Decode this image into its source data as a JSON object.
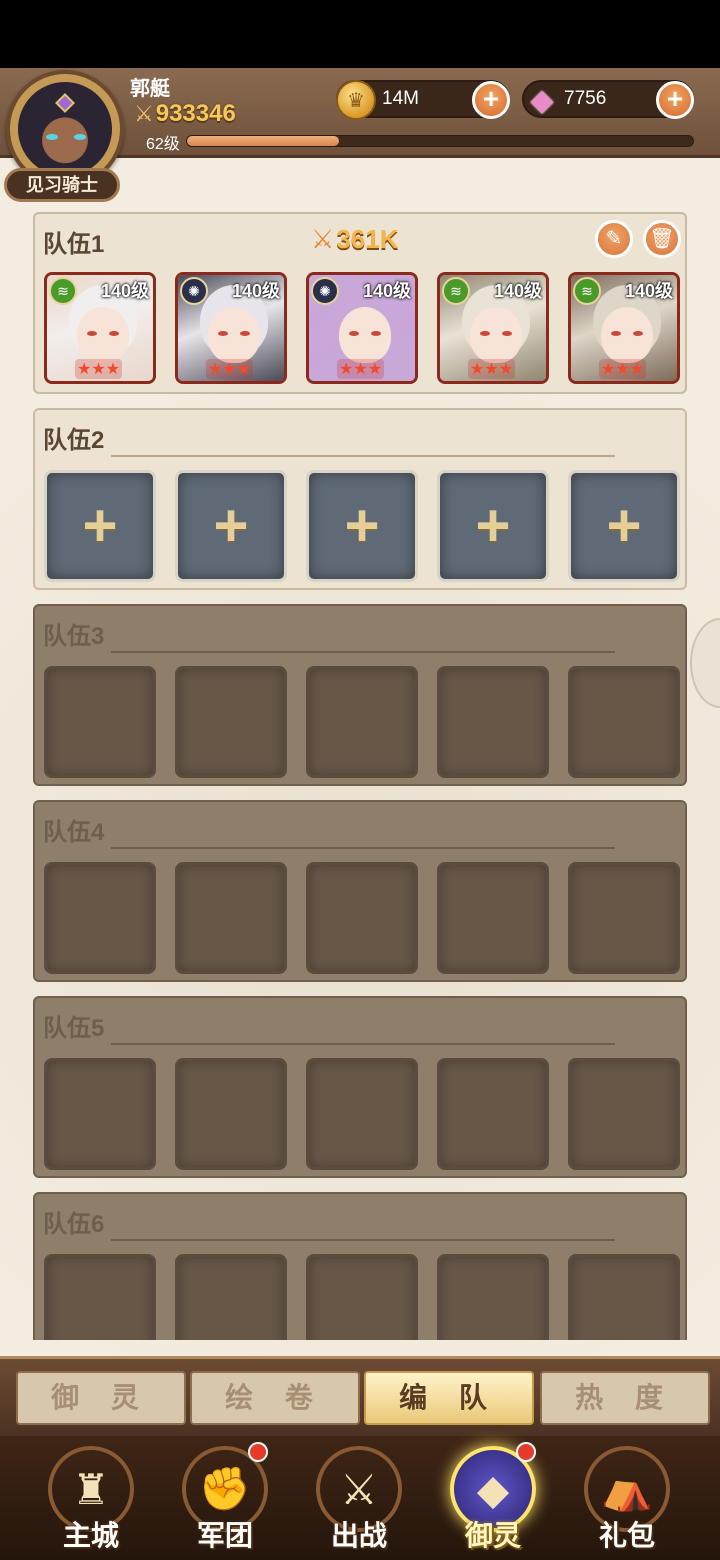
{
  "player": {
    "name": "郭艇",
    "power": "933346",
    "level_label": "62级",
    "level_progress": 0.3,
    "title": "见习骑士"
  },
  "resources": {
    "coins": "14M",
    "gems": "7756"
  },
  "teams": [
    {
      "label": "队伍1",
      "power": "361K",
      "heroes": [
        {
          "level": "140级",
          "element": "wind",
          "hair": "#f1eeee",
          "bg": "#e9d7c9",
          "accent": "#cf2a2a",
          "stars": "★★★"
        },
        {
          "level": "140级",
          "element": "dark",
          "hair": "#e8e4ec",
          "bg": "#4b4a55",
          "accent": "#7a1a1a",
          "stars": "★★★"
        },
        {
          "level": "140级",
          "element": "dark",
          "hair": "#c9a7d9",
          "bg": "#c7a8d7",
          "accent": "#8a5a9e",
          "stars": "★★★"
        },
        {
          "level": "140级",
          "element": "wind",
          "hair": "#e9e2d6",
          "bg": "#8f8670",
          "accent": "#c9a34a",
          "stars": "★★★"
        },
        {
          "level": "140级",
          "element": "wind",
          "hair": "#ddd6c9",
          "bg": "#7d6b5a",
          "accent": "#b8863a",
          "stars": "★★★"
        }
      ]
    },
    {
      "label": "队伍2"
    },
    {
      "label": "队伍3"
    },
    {
      "label": "队伍4"
    },
    {
      "label": "队伍5"
    },
    {
      "label": "队伍6"
    }
  ],
  "subtabs": [
    "御 灵",
    "绘 卷",
    "编 队",
    "热 度"
  ],
  "subtab_active_index": 2,
  "nav": [
    {
      "label": "主城",
      "icon": "castle-icon"
    },
    {
      "label": "军团",
      "icon": "legion-shield-icon"
    },
    {
      "label": "出战",
      "icon": "battle-gate-icon"
    },
    {
      "label": "御灵",
      "icon": "crystal-icon"
    },
    {
      "label": "礼包",
      "icon": "gift-shop-icon"
    }
  ],
  "nav_active_index": 3,
  "icons": {
    "plus": "+",
    "edit": "✎",
    "delete": "🗑",
    "swords": "⚔",
    "element_wind": "≋",
    "element_dark": "✺"
  },
  "colors": {
    "accent_orange": "#d9733a",
    "power_gold": "#f5b54a",
    "hero_frame": "#8b2a1c"
  }
}
